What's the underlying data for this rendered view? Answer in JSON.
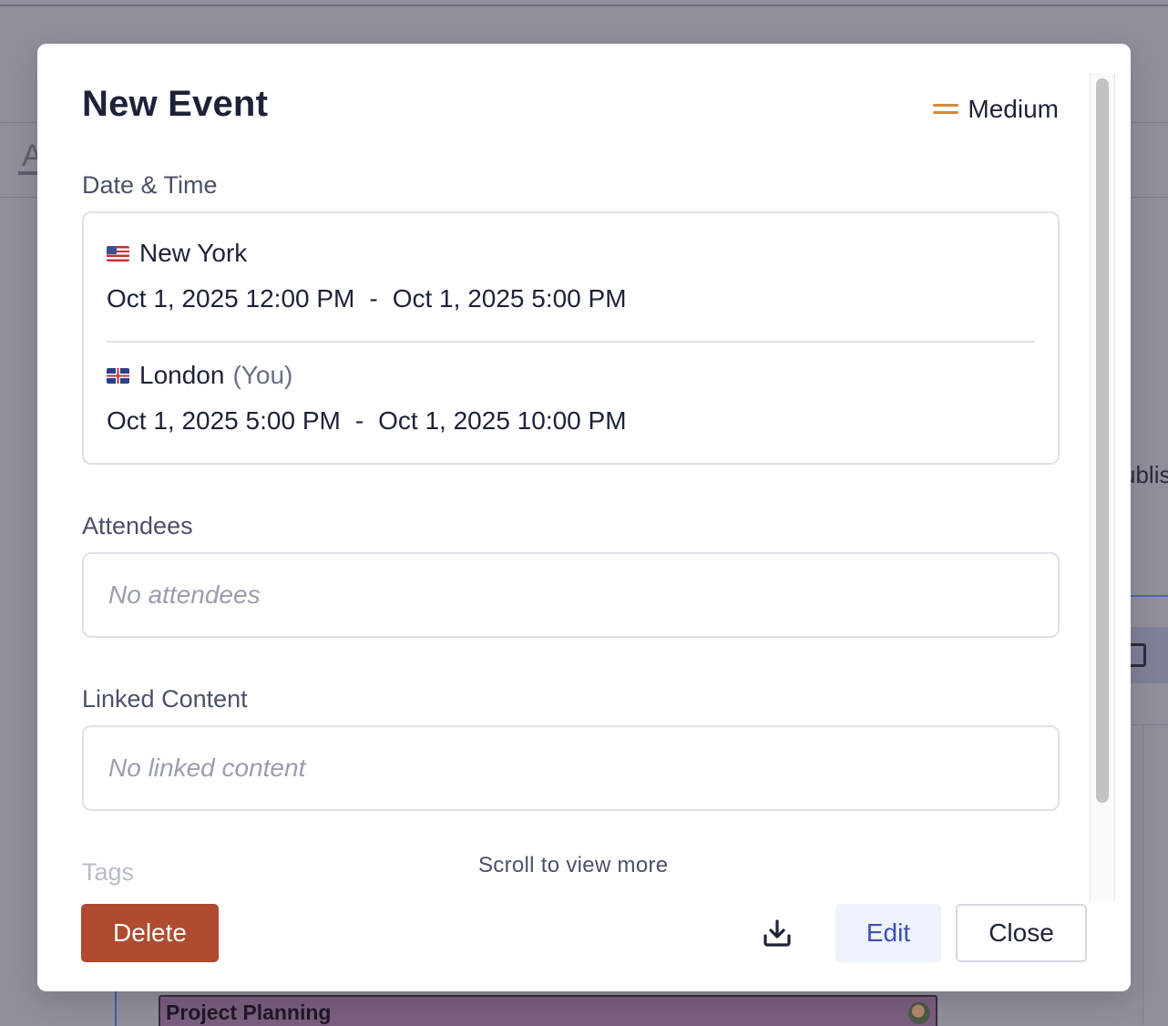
{
  "background": {
    "tab_letter": "A",
    "publish_fragment": "ublis",
    "event_title": "Project Planning"
  },
  "modal": {
    "title": "New Event",
    "priority": "Medium",
    "date_time": {
      "label": "Date & Time",
      "zones": [
        {
          "flag": "us-flag-icon",
          "name": "New York",
          "suffix": "",
          "start": "Oct 1, 2025 12:00 PM",
          "separator": "-",
          "end": "Oct 1, 2025 5:00 PM"
        },
        {
          "flag": "uk-flag-icon",
          "name": "London",
          "suffix": "(You)",
          "start": "Oct 1, 2025 5:00 PM",
          "separator": "-",
          "end": "Oct 1, 2025 10:00 PM"
        }
      ]
    },
    "attendees": {
      "label": "Attendees",
      "empty": "No attendees"
    },
    "linked_content": {
      "label": "Linked Content",
      "empty": "No linked content"
    },
    "tags": {
      "label": "Tags"
    },
    "scroll_hint": "Scroll to view more"
  },
  "footer": {
    "delete_label": "Delete",
    "download_icon": "download-icon",
    "edit_label": "Edit",
    "close_label": "Close"
  },
  "colors": {
    "priority_medium": "#d48a3a",
    "delete_bg": "#b04a30",
    "edit_bg": "#edf2fd",
    "edit_text": "#3d4fb8",
    "title_text": "#1d2238",
    "overlay": "#8e8f99"
  }
}
